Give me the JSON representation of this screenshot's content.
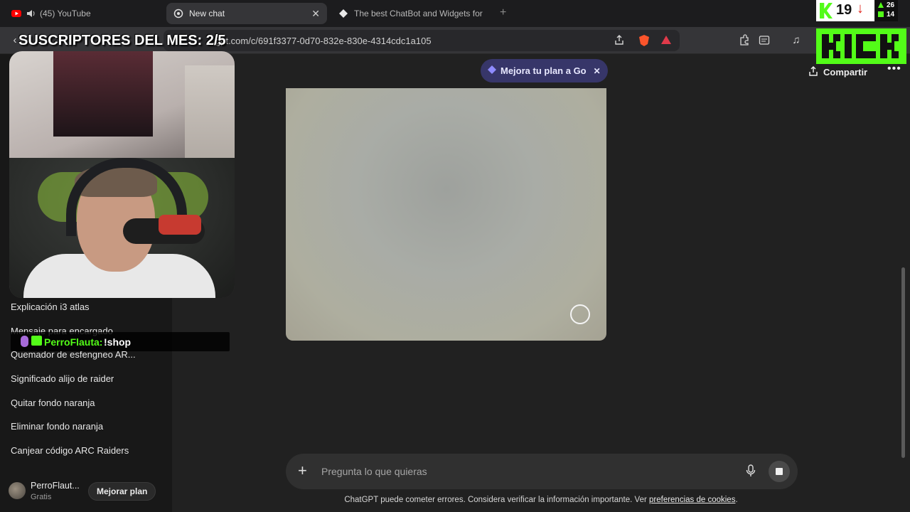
{
  "browser": {
    "tabs": [
      {
        "label": "(45) YouTube",
        "active": false
      },
      {
        "label": "New chat",
        "active": true
      },
      {
        "label": "The best ChatBot and Widgets for Ki",
        "active": false
      }
    ],
    "new_tab_symbol": "+",
    "url": "…gpt.com/c/691f3377-0d70-832e-830e-4314cdc1a105",
    "toolbar_icons": [
      "share-icon",
      "brave-shield-icon",
      "rewards-icon",
      "extensions-icon",
      "reader-icon",
      "media-icon",
      "sidebar-icon"
    ]
  },
  "sidebar": {
    "items": [
      {
        "label": "Explicación i3 atlas"
      },
      {
        "label": "Mensaje para encargado"
      },
      {
        "label": "Quemador de esfengneo AR..."
      },
      {
        "label": "Significado alijo de raider"
      },
      {
        "label": "Quitar fondo naranja"
      },
      {
        "label": "Eliminar fondo naranja"
      },
      {
        "label": "Canjear código ARC Raiders"
      }
    ],
    "user": {
      "name": "PerroFlaut...",
      "plan": "Gratis",
      "upgrade_label": "Mejorar plan"
    }
  },
  "main": {
    "upgrade_pill": "Mejora tu plan a Go",
    "share_label": "Compartir",
    "composer_placeholder": "Pregunta lo que quieras",
    "disclaimer_text": "ChatGPT puede cometer errores. Considera verificar la información importante. Ver ",
    "disclaimer_link": "preferencias de cookies",
    "disclaimer_end": "."
  },
  "overlay": {
    "subs_title": "SUSCRIPTORES DEL MES: 2/5",
    "chat_user": "PerroFlauta:",
    "chat_message": "!shop",
    "viewer_count": "19",
    "viewer_trend": "↓",
    "stat_top": "26",
    "stat_bottom": "14"
  },
  "colors": {
    "kick_green": "#53fc18",
    "bg": "#212121",
    "sidebar": "#181818",
    "pill": "#373669"
  }
}
